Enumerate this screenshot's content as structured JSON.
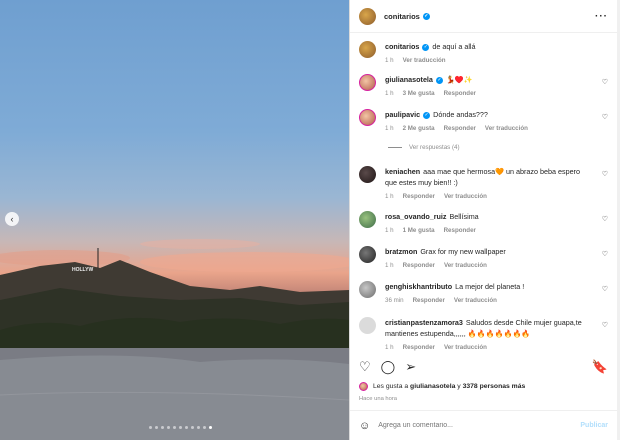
{
  "post": {
    "username": "conitarios",
    "more_icon": "more-horizontal-icon",
    "carousel_dots": 11,
    "active_dot": 10
  },
  "caption": {
    "user": "conitarios",
    "text": "de aquí a allá",
    "time": "1 h",
    "translate": "Ver traducción"
  },
  "comments": [
    {
      "user": "giulianasotela",
      "text": "💃♥️✨",
      "time": "1 h",
      "likes": "3 Me gusta",
      "reply": "Responder",
      "translate": ""
    },
    {
      "user": "paulipavic",
      "text": "Dónde andas???",
      "time": "1 h",
      "likes": "2 Me gusta",
      "reply": "Responder",
      "translate": "Ver traducción"
    },
    {
      "user": "keniachen",
      "text": "aaa mae que hermosa🧡 un abrazo beba espero que estes muy bien!! :)",
      "time": "1 h",
      "likes": "",
      "reply": "Responder",
      "translate": "Ver traducción"
    },
    {
      "user": "rosa_ovando_ruiz",
      "text": "Bellísima",
      "time": "1 h",
      "likes": "1 Me gusta",
      "reply": "Responder",
      "translate": ""
    },
    {
      "user": "bratzmon",
      "text": "Grax for my new wallpaper",
      "time": "1 h",
      "likes": "",
      "reply": "Responder",
      "translate": "Ver traducción"
    },
    {
      "user": "genghiskhantributo",
      "text": "La mejor del planeta !",
      "time": "36 min",
      "likes": "",
      "reply": "Responder",
      "translate": "Ver traducción"
    },
    {
      "user": "cristianpastenzamora3",
      "text": "Saludos desde Chile mujer guapa,te mantienes estupenda,,,,,, 🔥🔥🔥🔥🔥🔥🔥",
      "time": "1 h",
      "likes": "",
      "reply": "Responder",
      "translate": "Ver traducción"
    }
  ],
  "view_replies": "Ver respuestas (4)",
  "liked_by": {
    "prefix": "Les gusta a",
    "user": "giulianasotela",
    "middle": "y",
    "count": "3378 personas más"
  },
  "posted_time": "Hace una hora",
  "add_comment": {
    "placeholder": "Agrega un comentario...",
    "post_label": "Publicar"
  },
  "colors": {
    "accent": "#0095f6",
    "post_disabled": "#b2dffc"
  }
}
